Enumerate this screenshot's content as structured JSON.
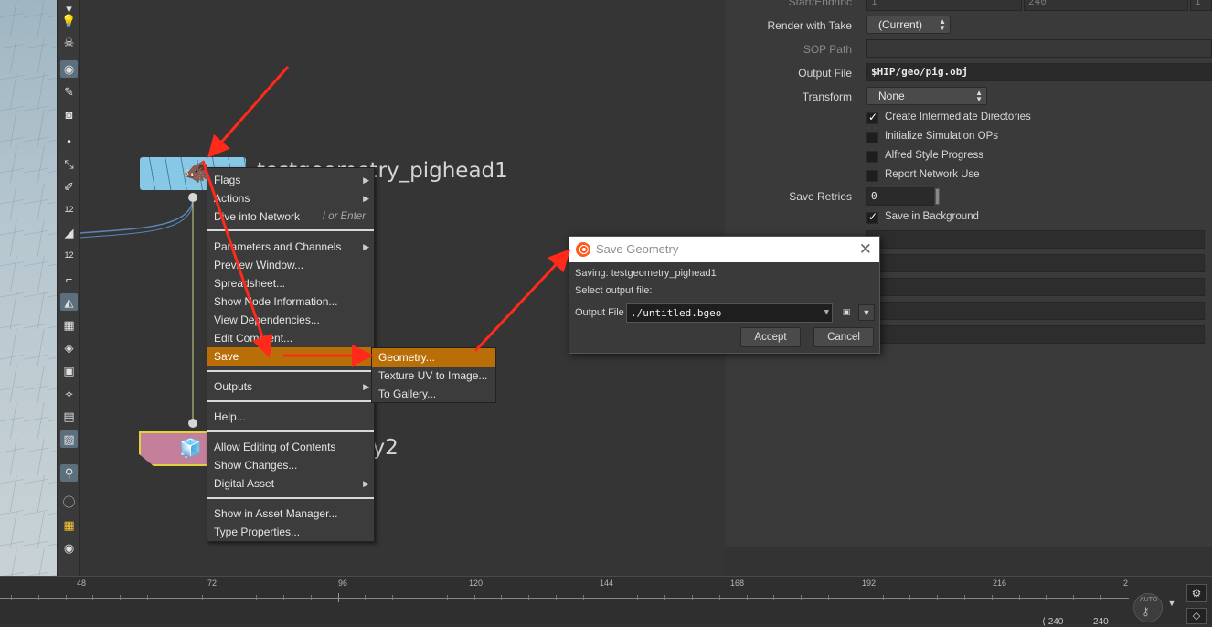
{
  "params": {
    "start_end_label": "Start/End/Inc",
    "start_end_values": [
      "1",
      "240",
      "1"
    ],
    "render_take_label": "Render with Take",
    "render_take_value": "(Current)",
    "sop_path_label": "SOP Path",
    "output_file_label": "Output File",
    "output_file_value": "$HIP/geo/pig.obj",
    "transform_label": "Transform",
    "transform_value": "None",
    "checkboxes": [
      {
        "label": "Create Intermediate Directories",
        "checked": true
      },
      {
        "label": "Initialize Simulation OPs",
        "checked": false
      },
      {
        "label": "Alfred Style Progress",
        "checked": false
      },
      {
        "label": "Report Network Use",
        "checked": false
      }
    ],
    "save_retries_label": "Save Retries",
    "save_retries_value": "0",
    "save_background_label": "Save in Background",
    "save_background_checked": true
  },
  "nodes": {
    "node1_name": "testgeometry_pighead1",
    "node2_name_tail": "ry2"
  },
  "context_menu": {
    "items": [
      {
        "label": "Flags",
        "submenu": true
      },
      {
        "label": "Actions",
        "submenu": true
      },
      {
        "label": "Dive into Network",
        "shortcut": "I or Enter"
      },
      {
        "label": "Parameters and Channels",
        "submenu": true
      },
      {
        "label": "Preview Window..."
      },
      {
        "label": "Spreadsheet..."
      },
      {
        "label": "Show Node Information..."
      },
      {
        "label": "View Dependencies..."
      },
      {
        "label": "Edit Comment..."
      },
      {
        "label": "Save",
        "submenu": true,
        "highlight": true
      },
      {
        "label": "Outputs",
        "submenu": true
      },
      {
        "label": "Help..."
      },
      {
        "label": "Allow Editing of Contents"
      },
      {
        "label": "Show Changes..."
      },
      {
        "label": "Digital Asset",
        "submenu": true
      },
      {
        "label": "Show in Asset Manager..."
      },
      {
        "label": "Type Properties..."
      }
    ]
  },
  "save_submenu": {
    "items": [
      "Geometry...",
      "Texture UV to Image...",
      "To Gallery..."
    ]
  },
  "dialog": {
    "title": "Save Geometry",
    "saving_text": "Saving: testgeometry_pighead1",
    "select_text": "Select output file:",
    "output_label": "Output File",
    "output_value": "./untitled.bgeo",
    "accept": "Accept",
    "cancel": "Cancel"
  },
  "timeline": {
    "ticks": [
      "48",
      "72",
      "96",
      "120",
      "144",
      "168",
      "192",
      "216",
      "2"
    ],
    "auto_label": "AUTO",
    "frame_values": [
      "240",
      "240"
    ]
  },
  "colors": {
    "highlight": "#b96e07",
    "arrow": "#ff2a1a",
    "node1": "#86c8e6",
    "node2": "#c4809a"
  }
}
